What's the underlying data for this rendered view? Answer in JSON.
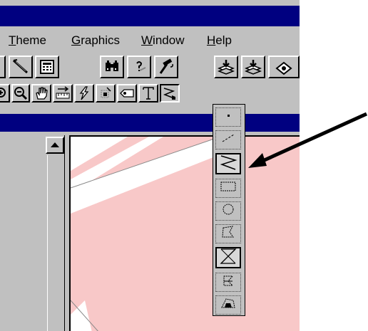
{
  "menubar": {
    "items": [
      {
        "accel": "T",
        "rest": "heme"
      },
      {
        "accel": "G",
        "rest": "raphics"
      },
      {
        "accel": "W",
        "rest": "indow"
      },
      {
        "accel": "H",
        "rest": "elp"
      }
    ]
  },
  "toolbar": {
    "buttons": [
      "partial-button-icon",
      "pen-tool-icon",
      "calculator-icon",
      "binoculars-icon",
      "query-builder-icon",
      "hammer-icon",
      "layer-add-icon",
      "layer-add-2-icon",
      "partial-button-icon"
    ]
  },
  "tools": {
    "buttons": [
      "zoom-in-icon",
      "zoom-out-icon",
      "pan-hand-icon",
      "measure-icon",
      "hotlink-icon",
      "select-graphics-icon",
      "label-icon",
      "text-icon",
      "draw-tool-icon"
    ]
  },
  "palette": {
    "tools": [
      "point-icon",
      "straight-line-icon",
      "polyline-icon",
      "rectangle-icon",
      "circle-icon",
      "polygon-icon",
      "line-split-icon",
      "polygon-split-icon",
      "auto-complete-icon"
    ],
    "selected_index": 2
  },
  "colors": {
    "title_bar": "#000080",
    "face": "#c0c0c0",
    "map_fill": "#f8c8c8",
    "arrow": "#000000"
  }
}
